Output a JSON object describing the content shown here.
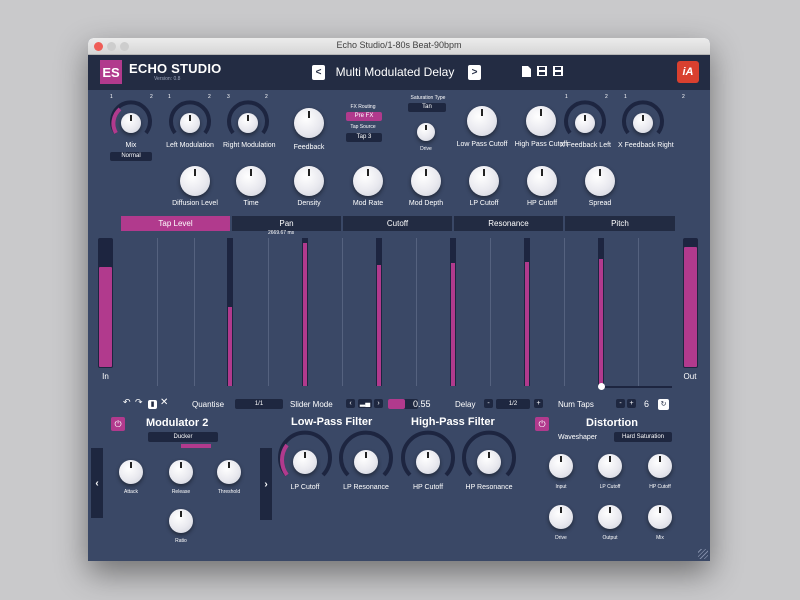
{
  "window": {
    "title": "Echo Studio/1-80s Beat-90bpm"
  },
  "header": {
    "logo": "ES",
    "brand": "ECHO STUDIO",
    "version": "Version: 0.8",
    "preset_name": "Multi Modulated Delay",
    "prev_label": "<",
    "next_label": ">",
    "brand_logo": "iA"
  },
  "top": {
    "mix_label": "Mix",
    "mix_mode": "Normal",
    "left_mod_label": "Left Modulation",
    "right_mod_label": "Right Modulation",
    "feedback_label": "Feedback",
    "fx_routing_label": "FX Routing",
    "fx_routing_value": "Pre FX",
    "tap_source_label": "Tap Source",
    "tap_source_value": "Tap 3",
    "saturation_type_label": "Saturation Type",
    "saturation_type_value": "Tan",
    "drive_label": "Drive",
    "low_pass_label": "Low Pass Cutoff",
    "high_pass_label": "High Pass Cutoff",
    "xfb_left_label": "X Feedback Left",
    "xfb_right_label": "X Feedback Right",
    "slot_1": "1",
    "slot_2": "2",
    "slot_3": "3"
  },
  "second_row": [
    "Diffusion Level",
    "Time",
    "Density",
    "Mod Rate",
    "Mod Depth",
    "LP Cutoff",
    "HP Cutoff",
    "Spread"
  ],
  "tabs": [
    "Tap Level",
    "Pan",
    "Cutoff",
    "Resonance",
    "Pitch"
  ],
  "taps": {
    "time_readout": "2669.67 ms",
    "in_label": "In",
    "out_label": "Out",
    "levels": [
      0.54,
      0.98,
      0.83,
      0.84,
      0.85,
      0.87
    ]
  },
  "controls": {
    "quantise_label": "Quantise",
    "quantise_value": "1/1",
    "slider_mode_label": "Slider Mode",
    "value_readout": "0.55",
    "delay_label": "Delay",
    "delay_value": "1/2",
    "num_taps_label": "Num Taps",
    "num_taps_value": "6",
    "minus": "-",
    "plus": "+"
  },
  "modulator": {
    "title": "Modulator 2",
    "mode": "Ducker",
    "attack": "Attack",
    "release": "Release",
    "threshold": "Threshold",
    "ratio": "Ratio"
  },
  "filters": {
    "lp_title": "Low-Pass Filter",
    "hp_title": "High-Pass Filter",
    "lp_cutoff": "LP Cutoff",
    "lp_resonance": "LP Resonance",
    "hp_cutoff": "HP Cutoff",
    "hp_resonance": "HP Resonance"
  },
  "distortion": {
    "title": "Distortion",
    "waveshaper_label": "Waveshaper",
    "waveshaper_value": "Hard Saturation",
    "input": "Input",
    "lp_cutoff": "LP Cutoff",
    "hp_cutoff": "HP Cutoff",
    "drive": "Drive",
    "output": "Output",
    "mix": "Mix"
  },
  "colors": {
    "accent": "#b13a8d",
    "panel": "#3a4866",
    "header": "#232c43",
    "brand_red": "#d9402f"
  }
}
